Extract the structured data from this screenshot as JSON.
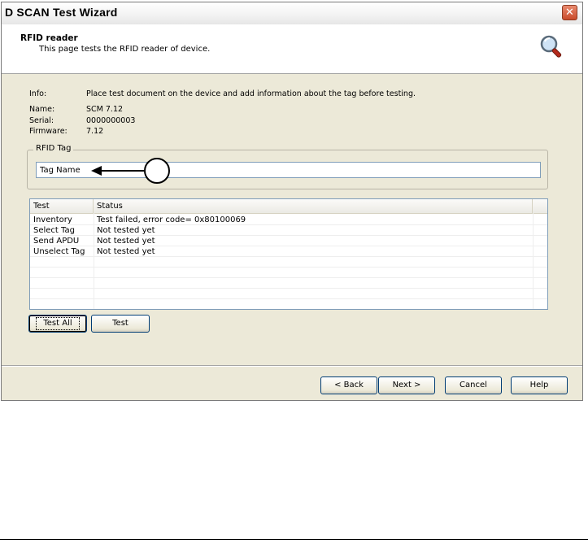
{
  "window": {
    "title": "D SCAN Test Wizard",
    "close_glyph": "✕"
  },
  "header": {
    "title": "RFID reader",
    "subtitle": "This page tests the RFID reader of device.",
    "icon": "magnifier-icon"
  },
  "info": {
    "info_label": "Info:",
    "info_text": "Place test document on the device and add information about the tag before testing.",
    "name_label": "Name:",
    "name_value": "SCM 7.12",
    "serial_label": "Serial:",
    "serial_value": "0000000003",
    "firmware_label": "Firmware:",
    "firmware_value": "7.12"
  },
  "rfid_tag": {
    "group_label": "RFID Tag",
    "value": "Tag Name"
  },
  "test_list": {
    "columns": [
      "Test",
      "Status"
    ],
    "rows": [
      {
        "test": "Inventory",
        "status": "Test failed, error code= 0x80100069"
      },
      {
        "test": "Select Tag",
        "status": "Not tested yet"
      },
      {
        "test": "Send APDU",
        "status": "Not tested yet"
      },
      {
        "test": "Unselect Tag",
        "status": "Not tested yet"
      }
    ]
  },
  "buttons": {
    "test_all": "Test All",
    "test": "Test",
    "back": "< Back",
    "next": "Next >",
    "cancel": "Cancel",
    "help": "Help"
  },
  "colors": {
    "window_bg": "#ece9d8",
    "border_blue": "#003c74",
    "close_red": "#c94b2b"
  }
}
